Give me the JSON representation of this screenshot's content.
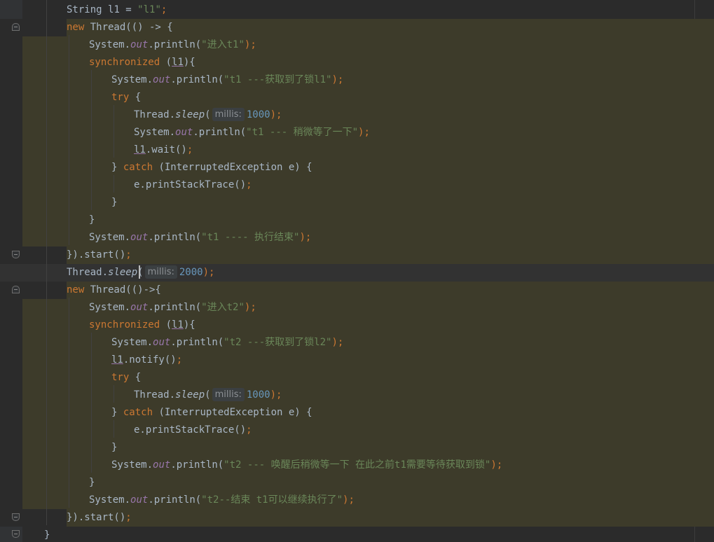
{
  "editor": {
    "lines": [
      {
        "tokens": [
          [
            "String ",
            "default"
          ],
          [
            "l1 = ",
            "default"
          ],
          [
            "\"l1\"",
            "str"
          ],
          [
            ";",
            "punc"
          ]
        ]
      },
      {
        "tokens": [
          [
            "new ",
            "kw"
          ],
          [
            "Thread(() -> {",
            "default"
          ]
        ]
      },
      {
        "tokens": [
          [
            "System.",
            "default"
          ],
          [
            "out",
            "fld"
          ],
          [
            ".println(",
            "default"
          ],
          [
            "\"进入t1\"",
            "str"
          ],
          [
            ");",
            "punc"
          ]
        ]
      },
      {
        "tokens": [
          [
            "synchronized ",
            "kw"
          ],
          [
            "(",
            "default"
          ],
          [
            "l1",
            "var"
          ],
          [
            "){",
            "default"
          ]
        ]
      },
      {
        "tokens": [
          [
            "System.",
            "default"
          ],
          [
            "out",
            "fld"
          ],
          [
            ".println(",
            "default"
          ],
          [
            "\"t1 ---获取到了锁l1\"",
            "str"
          ],
          [
            ");",
            "punc"
          ]
        ]
      },
      {
        "tokens": [
          [
            "try ",
            "kw"
          ],
          [
            "{",
            "default"
          ]
        ]
      },
      {
        "tokens": [
          [
            "Thread.",
            "default"
          ],
          [
            "sleep",
            "mth"
          ],
          [
            "(",
            "default"
          ],
          [
            "millis:",
            "hint"
          ],
          [
            "1000",
            "num"
          ],
          [
            ");",
            "punc"
          ]
        ]
      },
      {
        "tokens": [
          [
            "System.",
            "default"
          ],
          [
            "out",
            "fld"
          ],
          [
            ".println(",
            "default"
          ],
          [
            "\"t1 --- 稍微等了一下\"",
            "str"
          ],
          [
            ");",
            "punc"
          ]
        ]
      },
      {
        "tokens": [
          [
            "l1",
            "var"
          ],
          [
            ".wait()",
            "default"
          ],
          [
            ";",
            "punc"
          ]
        ]
      },
      {
        "tokens": [
          [
            "} ",
            "default"
          ],
          [
            "catch ",
            "kw"
          ],
          [
            "(InterruptedException e) {",
            "default"
          ]
        ]
      },
      {
        "tokens": [
          [
            "e.printStackTrace()",
            "default"
          ],
          [
            ";",
            "punc"
          ]
        ]
      },
      {
        "tokens": [
          [
            "}",
            "default"
          ]
        ]
      },
      {
        "tokens": [
          [
            "}",
            "default"
          ]
        ]
      },
      {
        "tokens": [
          [
            "System.",
            "default"
          ],
          [
            "out",
            "fld"
          ],
          [
            ".println(",
            "default"
          ],
          [
            "\"t1 ---- 执行结束\"",
            "str"
          ],
          [
            ");",
            "punc"
          ]
        ]
      },
      {
        "tokens": [
          [
            "}).start()",
            "default"
          ],
          [
            ";",
            "punc"
          ]
        ]
      },
      {
        "tokens": [
          [
            "Thread.",
            "default"
          ],
          [
            "sleep",
            "mth"
          ],
          [
            "(",
            "default"
          ],
          [
            "millis:",
            "hint"
          ],
          [
            "2000",
            "num"
          ],
          [
            ");",
            "punc"
          ]
        ]
      },
      {
        "tokens": [
          [
            "new ",
            "kw"
          ],
          [
            "Thread(()->{",
            "default"
          ]
        ]
      },
      {
        "tokens": [
          [
            "System.",
            "default"
          ],
          [
            "out",
            "fld"
          ],
          [
            ".println(",
            "default"
          ],
          [
            "\"进入t2\"",
            "str"
          ],
          [
            ");",
            "punc"
          ]
        ]
      },
      {
        "tokens": [
          [
            "synchronized ",
            "kw"
          ],
          [
            "(",
            "default"
          ],
          [
            "l1",
            "var"
          ],
          [
            "){",
            "default"
          ]
        ]
      },
      {
        "tokens": [
          [
            "System.",
            "default"
          ],
          [
            "out",
            "fld"
          ],
          [
            ".println(",
            "default"
          ],
          [
            "\"t2 ---获取到了锁l2\"",
            "str"
          ],
          [
            ");",
            "punc"
          ]
        ]
      },
      {
        "tokens": [
          [
            "l1",
            "var"
          ],
          [
            ".notify()",
            "default"
          ],
          [
            ";",
            "punc"
          ]
        ]
      },
      {
        "tokens": [
          [
            "try ",
            "kw"
          ],
          [
            "{",
            "default"
          ]
        ]
      },
      {
        "tokens": [
          [
            "Thread.",
            "default"
          ],
          [
            "sleep",
            "mth"
          ],
          [
            "(",
            "default"
          ],
          [
            "millis:",
            "hint"
          ],
          [
            "1000",
            "num"
          ],
          [
            ");",
            "punc"
          ]
        ]
      },
      {
        "tokens": [
          [
            "} ",
            "default"
          ],
          [
            "catch ",
            "kw"
          ],
          [
            "(InterruptedException e) {",
            "default"
          ]
        ]
      },
      {
        "tokens": [
          [
            "e.printStackTrace()",
            "default"
          ],
          [
            ";",
            "punc"
          ]
        ]
      },
      {
        "tokens": [
          [
            "}",
            "default"
          ]
        ]
      },
      {
        "tokens": [
          [
            "System.",
            "default"
          ],
          [
            "out",
            "fld"
          ],
          [
            ".println(",
            "default"
          ],
          [
            "\"t2 --- 唤醒后稍微等一下 在此之前t1需要等待获取到锁\"",
            "str"
          ],
          [
            ");",
            "punc"
          ]
        ]
      },
      {
        "tokens": [
          [
            "}",
            "default"
          ]
        ]
      },
      {
        "tokens": [
          [
            "System.",
            "default"
          ],
          [
            "out",
            "fld"
          ],
          [
            ".println(",
            "default"
          ],
          [
            "\"t2--结束 t1可以继续执行了\"",
            "str"
          ],
          [
            ");",
            "punc"
          ]
        ]
      },
      {
        "tokens": [
          [
            "}).start()",
            "default"
          ],
          [
            ";",
            "punc"
          ]
        ]
      },
      {
        "tokens": [
          [
            "}",
            "default"
          ]
        ]
      }
    ]
  }
}
